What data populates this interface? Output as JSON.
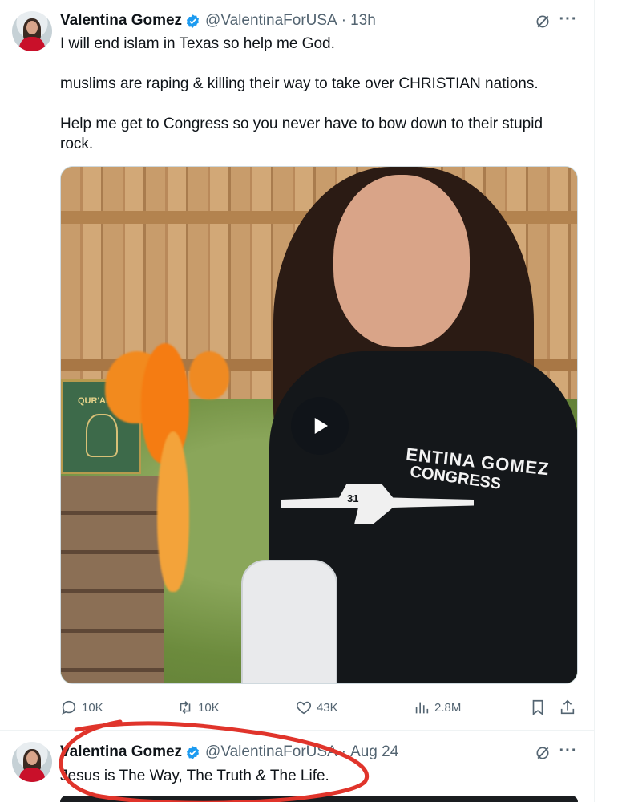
{
  "tweets": [
    {
      "author": "Valentina Gomez",
      "handle": "@ValentinaForUSA",
      "time": "13h",
      "paragraphs": [
        "I will end islam in Texas so help me God.",
        "muslims are raping & killing their way to take over CHRISTIAN nations.",
        "Help me get to Congress so you never have to bow down to their stupid rock."
      ],
      "media": {
        "shirt_line1": "ENTINA GOMEZ",
        "shirt_line2": "CONGRESS",
        "gun_number": "31",
        "book_title": "QUR'AN"
      },
      "stats": {
        "replies": "10K",
        "reposts": "10K",
        "likes": "43K",
        "views": "2.8M"
      }
    },
    {
      "author": "Valentina Gomez",
      "handle": "@ValentinaForUSA",
      "time": "Aug 24",
      "text": "Jesus is The Way, The Truth & The Life."
    }
  ],
  "colors": {
    "verified": "#1d9bf0",
    "muted": "#536471",
    "annotation": "#e0342b"
  },
  "icons": [
    "verified-badge-icon",
    "grok-icon",
    "more-icon",
    "reply-icon",
    "repost-icon",
    "like-icon",
    "views-icon",
    "bookmark-icon",
    "share-icon",
    "play-icon"
  ]
}
